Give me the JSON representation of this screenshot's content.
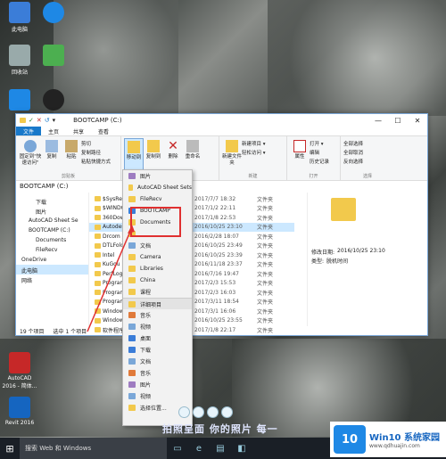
{
  "desktop": {
    "icons": [
      {
        "label": "此电脑",
        "color": "#3b7dd8"
      },
      {
        "label": "",
        "color": "#1e88e5"
      },
      {
        "label": "回收站",
        "color": "#9aa"
      },
      {
        "label": "",
        "color": "#4caf50"
      },
      {
        "label": "",
        "color": "#1e88e5"
      },
      {
        "label": "",
        "color": "#222"
      },
      {
        "label": "AutoCAD 2016 - 简体...",
        "color": "#c62828"
      },
      {
        "label": "Revit 2016",
        "color": "#1565c0"
      }
    ]
  },
  "window": {
    "title": "BOOTCAMP (C:)",
    "quick_access": [
      "✓",
      "✕",
      "↺",
      "▾"
    ],
    "controls": [
      "—",
      "☐",
      "✕"
    ],
    "tabs": [
      "文件",
      "主页",
      "共享",
      "查看"
    ],
    "ribbon": {
      "pin_label": "固定到\"快速访问\"",
      "copy_label": "复制",
      "paste_label": "粘贴",
      "cut_label": "剪切",
      "copy_path_label": "复制路径",
      "paste_shortcut_label": "粘贴快捷方式",
      "clipboard_group": "剪贴板",
      "move_to_label": "移动到",
      "copy_to_label": "复制到",
      "delete_label": "删除",
      "rename_label": "重命名",
      "new_folder_label": "新建文件夹",
      "new_item_label": "新建项目 ▾",
      "easy_access_label": "轻松访问 ▾",
      "properties_label": "属性",
      "open_label": "打开 ▾",
      "edit_label": "编辑",
      "history_label": "历史记录",
      "select_all_label": "全部选择",
      "select_none_label": "全部取消",
      "invert_label": "反向选择",
      "new_group": "新建",
      "open_group": "打开",
      "select_group": "选择"
    },
    "address": "BOOTCAMP (C:)",
    "nav_items": [
      "下载",
      "图片",
      "AutoCAD Sheet Se",
      "BOOTCAMP (C:)",
      "Documents",
      "FileRecv",
      "OneDrive",
      "此电脑",
      "网络"
    ],
    "files": [
      {
        "name": "$SysReset",
        "date": "2017/7/7 18:32",
        "type": "文件夹"
      },
      {
        "name": "$WINDOWS",
        "date": "2017/1/2 22:11",
        "type": "文件夹"
      },
      {
        "name": "360Down",
        "date": "2017/1/8 22:53",
        "type": "文件夹"
      },
      {
        "name": "Autodesk",
        "date": "2016/10/25 23:10",
        "type": "文件夹"
      },
      {
        "name": "Drcom",
        "date": "2016/2/28 18:07",
        "type": "文件夹"
      },
      {
        "name": "DTLFolde",
        "date": "2016/10/25 23:49",
        "type": "文件夹"
      },
      {
        "name": "Intel",
        "date": "2016/10/25 23:39",
        "type": "文件夹"
      },
      {
        "name": "KuGou",
        "date": "2016/11/18 23:37",
        "type": "文件夹"
      },
      {
        "name": "PerfLogs",
        "date": "2016/7/16 19:47",
        "type": "文件夹"
      },
      {
        "name": "Program",
        "date": "2017/2/3 15:53",
        "type": "文件夹"
      },
      {
        "name": "Program",
        "date": "2017/2/3 16:03",
        "type": "文件夹"
      },
      {
        "name": "ProgramI",
        "date": "2017/3/11 18:54",
        "type": "文件夹"
      },
      {
        "name": "Windows",
        "date": "2017/3/1 16:06",
        "type": "文件夹"
      },
      {
        "name": "Windows.",
        "date": "2016/10/25 23:55",
        "type": "文件夹"
      },
      {
        "name": "软件程序",
        "date": "2017/1/8 22:17",
        "type": "文件夹"
      }
    ],
    "status": {
      "count": "19 个项目",
      "selected": "选中 1 个项目"
    },
    "preview": {
      "modified_label": "修改日期:",
      "modified_value": "2016/10/25 23:10",
      "type_label": "类型:",
      "type_value": "脱机时间"
    }
  },
  "menu": {
    "items": [
      {
        "label": "图片",
        "color": "#9e7cc1"
      },
      {
        "label": "AutoCAD Sheet Sets",
        "color": "#f2c94c"
      },
      {
        "label": "FileRecv",
        "color": "#f2c94c"
      },
      {
        "label": "BOOTCAMP",
        "color": "#3b7dd8"
      },
      {
        "label": "Documents",
        "color": "#f2c94c"
      },
      {
        "label": "",
        "color": "#f2c94c"
      },
      {
        "label": "文档",
        "color": "#7aa7d8"
      },
      {
        "label": "Camera",
        "color": "#f2c94c"
      },
      {
        "label": "Libraries",
        "color": "#f2c94c"
      },
      {
        "label": "China",
        "color": "#f2c94c"
      },
      {
        "label": "课程",
        "color": "#f2c94c"
      },
      {
        "label": "详细项目",
        "color": "#f2c94c"
      },
      {
        "label": "音乐",
        "color": "#e07a3a"
      },
      {
        "label": "视频",
        "color": "#7aa7d8"
      },
      {
        "label": "桌面",
        "color": "#3b7dd8"
      },
      {
        "label": "下载",
        "color": "#3b7dd8"
      },
      {
        "label": "文档",
        "color": "#7aa7d8"
      },
      {
        "label": "音乐",
        "color": "#e07a3a"
      },
      {
        "label": "图片",
        "color": "#9e7cc1"
      },
      {
        "label": "视频",
        "color": "#7aa7d8"
      },
      {
        "label": "选择位置...",
        "color": "#f2c94c"
      }
    ]
  },
  "taskbar": {
    "start": "⊞",
    "search_text": "搜索 Web 和 Windows",
    "icons": [
      "▭",
      "e",
      "▤",
      "◧"
    ]
  },
  "caption": "拍照呈面 你的照片 每一",
  "watermark": {
    "logo": "10",
    "main": "Win10 系统家园",
    "sub": "www.qdhuajin.com"
  },
  "colors": {
    "accent": "#1979ca",
    "highlight": "#e03030"
  }
}
